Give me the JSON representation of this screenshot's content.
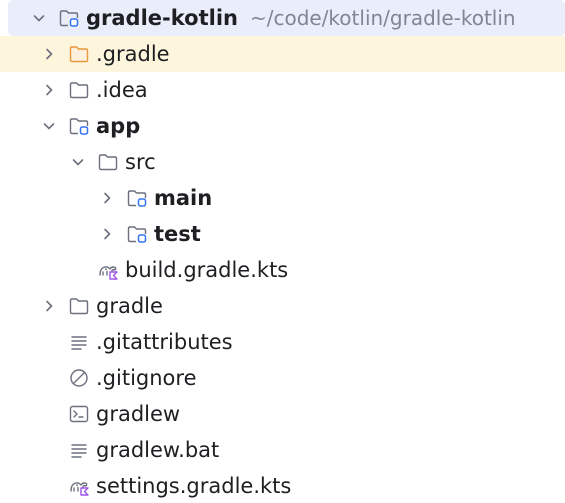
{
  "root": {
    "name": "gradle-kotlin",
    "path": "~/code/kotlin/gradle-kotlin",
    "expanded": true,
    "icon": "module-folder-icon"
  },
  "items": [
    {
      "key": "dot-gradle",
      "label": ".gradle",
      "expanded": false,
      "has_children": true,
      "icon": "excluded-folder-icon"
    },
    {
      "key": "dot-idea",
      "label": ".idea",
      "expanded": false,
      "has_children": true,
      "icon": "folder-icon"
    },
    {
      "key": "app",
      "label": "app",
      "expanded": true,
      "has_children": true,
      "icon": "module-folder-icon"
    },
    {
      "key": "src",
      "label": "src",
      "expanded": true,
      "has_children": true,
      "icon": "folder-icon"
    },
    {
      "key": "main",
      "label": "main",
      "expanded": false,
      "has_children": true,
      "icon": "module-folder-icon"
    },
    {
      "key": "test",
      "label": "test",
      "expanded": false,
      "has_children": true,
      "icon": "module-folder-icon"
    },
    {
      "key": "app-build",
      "label": "build.gradle.kts",
      "has_children": false,
      "icon": "gradle-kotlin-script-icon"
    },
    {
      "key": "gradle",
      "label": "gradle",
      "expanded": false,
      "has_children": true,
      "icon": "folder-icon"
    },
    {
      "key": "gitattributes",
      "label": ".gitattributes",
      "has_children": false,
      "icon": "text-file-icon"
    },
    {
      "key": "gitignore",
      "label": ".gitignore",
      "has_children": false,
      "icon": "ignore-file-icon"
    },
    {
      "key": "gradlew",
      "label": "gradlew",
      "has_children": false,
      "icon": "shell-script-icon"
    },
    {
      "key": "gradlew-bat",
      "label": "gradlew.bat",
      "has_children": false,
      "icon": "text-file-icon"
    },
    {
      "key": "settings",
      "label": "settings.gradle.kts",
      "has_children": false,
      "icon": "gradle-kotlin-script-icon"
    }
  ],
  "colors": {
    "selection": "#e9eefa",
    "excluded_highlight": "#fdf5dc",
    "excluded_folder": "#e8983d",
    "module_marker": "#3574f0",
    "kotlin_marker": "#9f56e8",
    "path_text": "#818594",
    "icon_stroke": "#6c707e"
  }
}
